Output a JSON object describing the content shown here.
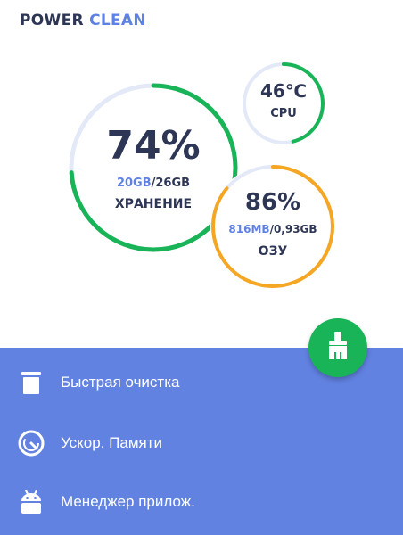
{
  "app": {
    "title_part1": "POWER",
    "title_part2": "CLEAN"
  },
  "storage": {
    "percent_label": "74%",
    "percent": 74,
    "used": "20GB",
    "separator": "/",
    "total": "26GB",
    "label": "ХРАНЕНИЕ",
    "color": "#19b458"
  },
  "cpu": {
    "temp_label": "46℃",
    "label": "CPU",
    "fill_percent": 46,
    "color": "#19b458"
  },
  "ram": {
    "percent_label": "86%",
    "percent": 86,
    "used": "816MB",
    "separator": "/",
    "total": "0,93GB",
    "label": "ОЗУ",
    "color": "#f5a623"
  },
  "track_color": "#e3e9f7",
  "menu": {
    "background": "#6282e2",
    "items": [
      {
        "label": "Быстрая очистка",
        "icon": "trash-icon"
      },
      {
        "label": "Ускор. Памяти",
        "icon": "speedometer-icon"
      },
      {
        "label": "Менеджер прилож.",
        "icon": "android-icon"
      }
    ]
  },
  "fab": {
    "icon": "broom-icon",
    "color": "#19b458"
  }
}
